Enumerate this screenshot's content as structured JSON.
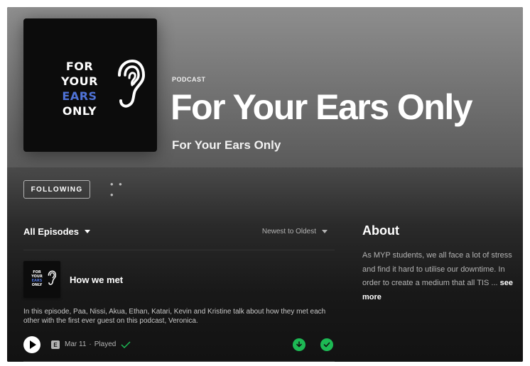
{
  "podcast": {
    "type_label": "PODCAST",
    "title": "For Your Ears Only",
    "publisher": "For Your Ears Only",
    "cover_lines": [
      "FOR",
      "YOUR",
      "EARS",
      "ONLY"
    ]
  },
  "actions": {
    "follow_label": "FOLLOWING",
    "more_label": "• • •"
  },
  "episodes_header": {
    "filter_label": "All Episodes",
    "sort_label": "Newest to Oldest"
  },
  "episodes": [
    {
      "title": "How we met",
      "description": "In this episode, Paa, Nissi, Akua, Ethan, Katari, Kevin and Kristine talk about how they met each other with the first ever guest on this podcast, Veronica.",
      "explicit_label": "E",
      "date": "Mar 11",
      "separator": "·",
      "status": "Played"
    }
  ],
  "about": {
    "heading": "About",
    "text": "As MYP students, we all face a lot of stress and find it hard to utilise our downtime. In order to create a medium that all TIS ...",
    "see_more": "see more"
  },
  "colors": {
    "accent": "#1db954",
    "ears_blue": "#4f73d8",
    "background": "#121212"
  },
  "icons": [
    "ear-icon",
    "chevron-down-icon",
    "play-icon",
    "explicit-icon",
    "check-icon",
    "download-icon",
    "downloaded-check-icon"
  ]
}
